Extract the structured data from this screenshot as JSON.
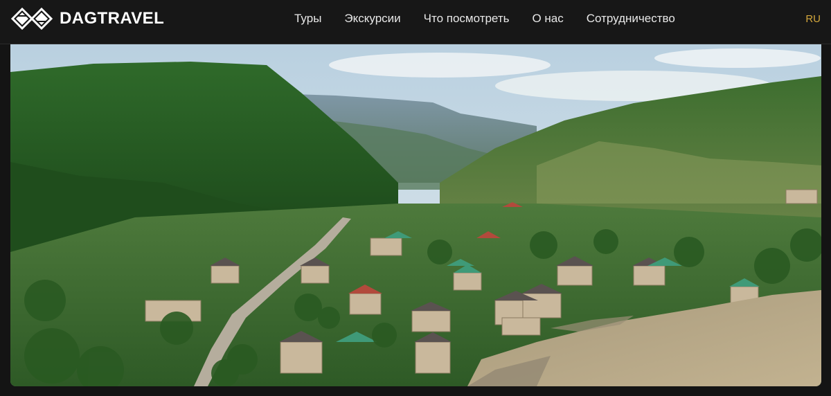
{
  "header": {
    "brand": "DAGTRAVEL",
    "logo_icon": "dagtravel-diamond-logo",
    "nav": [
      {
        "label": "Туры"
      },
      {
        "label": "Экскурсии"
      },
      {
        "label": "Что посмотреть"
      },
      {
        "label": "О нас"
      },
      {
        "label": "Сотрудничество"
      }
    ],
    "language": "RU"
  },
  "hero": {
    "image_subject": "mountain valley village landscape photo"
  },
  "colors": {
    "background": "#141414",
    "header_bg": "#171717",
    "lang_accent": "#d2a63c"
  }
}
